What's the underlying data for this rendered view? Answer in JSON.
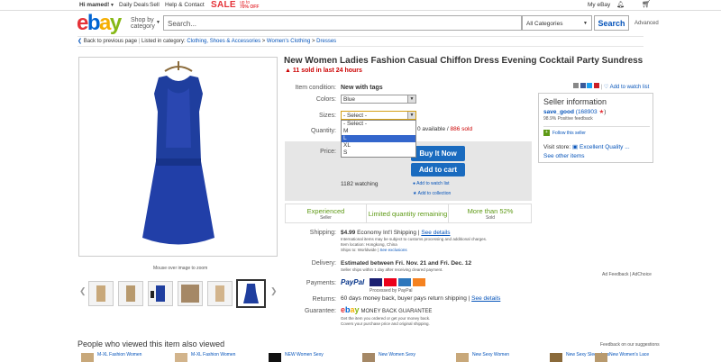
{
  "topbar": {
    "greeting": "Hi mamed!",
    "daily_deals": "Daily Deals",
    "sell": "Sell",
    "help": "Help & Contact",
    "sale": "SALE",
    "sale_sub1": "up to",
    "sale_sub2": "70% OFF",
    "my_ebay": "My eBay"
  },
  "header": {
    "logo": [
      "e",
      "b",
      "a",
      "y"
    ],
    "shop_by": "Shop by",
    "category": "category",
    "search_placeholder": "Search...",
    "all_categories": "All Categories",
    "search_button": "Search",
    "advanced": "Advanced"
  },
  "breadcrumb": {
    "back": "Back to previous page",
    "listed": "Listed in category:",
    "items": [
      "Clothing, Shoes & Accessories",
      "Women's Clothing",
      "Dresses"
    ]
  },
  "gallery": {
    "mouse_over": "Mouse over image to zoom",
    "thumb_count": 8
  },
  "item": {
    "title": "New Women Ladies Fashion Casual Chiffon Dress Evening Cocktail Party Sundress",
    "sold_recent": "11 sold in last 24 hours",
    "condition_label": "Item condition:",
    "condition_value": "New with tags",
    "colors_label": "Colors:",
    "colors_value": "Blue",
    "sizes_label": "Sizes:",
    "sizes_value": "- Select -",
    "size_options": [
      "- Select -",
      "M",
      "L",
      "XL",
      "S"
    ],
    "quantity_label": "Quantity:",
    "available": "0 available",
    "sold": "886 sold",
    "price_label": "Price:",
    "buy_now": "Buy It Now",
    "add_to_cart": "Add to cart",
    "watching": "1182 watching",
    "add_watch": "Add to watch list",
    "add_collection": "Add to collection",
    "badges": [
      {
        "title": "Experienced",
        "sub": "Seller"
      },
      {
        "title": "Limited quantity remaining",
        "sub": ""
      },
      {
        "title": "More than 52%",
        "sub": "Sold"
      }
    ],
    "shipping_label": "Shipping:",
    "shipping_value": "$4.99",
    "shipping_type": "Economy Int'l Shipping",
    "see_details": "See details",
    "shipping_note": "International items may be subject to customs processing and additional charges.",
    "item_location": "Item location: Hongkong, China",
    "ships_to": "Ships to: Worldwide",
    "see_exclusions": "See exclusions",
    "delivery_label": "Delivery:",
    "delivery_value": "Estimated between Fri. Nov. 21 and Fri. Dec. 12",
    "delivery_note": "Seller ships within 1 day after receiving cleared payment.",
    "payments_label": "Payments:",
    "payments_paypal": "PayPal",
    "processed_by": "Processed by PayPal",
    "returns_label": "Returns:",
    "returns_value": "60 days money back, buyer pays return shipping",
    "guarantee_label": "Guarantee:",
    "guarantee_value": "MONEY BACK GUARANTEE",
    "guarantee_note1": "Get the item you ordered or get your money back.",
    "guarantee_note2": "Covers your purchase price and original shipping."
  },
  "share": {
    "add_watch": "Add to watch list"
  },
  "seller": {
    "heading": "Seller information",
    "name": "save_good",
    "feedback": "(168903",
    "positive": "98.9% Positive feedback",
    "follow": "Follow this seller",
    "visit_store": "Visit store:",
    "store_name": "Excellent Quality ...",
    "see_other": "See other items"
  },
  "ad": {
    "feedback": "Ad Feedback",
    "adchoice": "AdChoice"
  },
  "related": {
    "heading": "People who viewed this item also viewed",
    "feedback": "Feedback on our suggestions",
    "items": [
      "M-XL Fashion Women",
      "M-XL Fashion Women",
      "NEW Women Sexy",
      "New Women Sexy",
      "New Sexy Women",
      "New Sexy Sleeveless",
      "New Women's Lace"
    ]
  },
  "colors": {
    "accent": "#0654ba",
    "sale": "#e53238",
    "buy_button": "#1a6bbf",
    "badge_green": "#5e9a16"
  }
}
